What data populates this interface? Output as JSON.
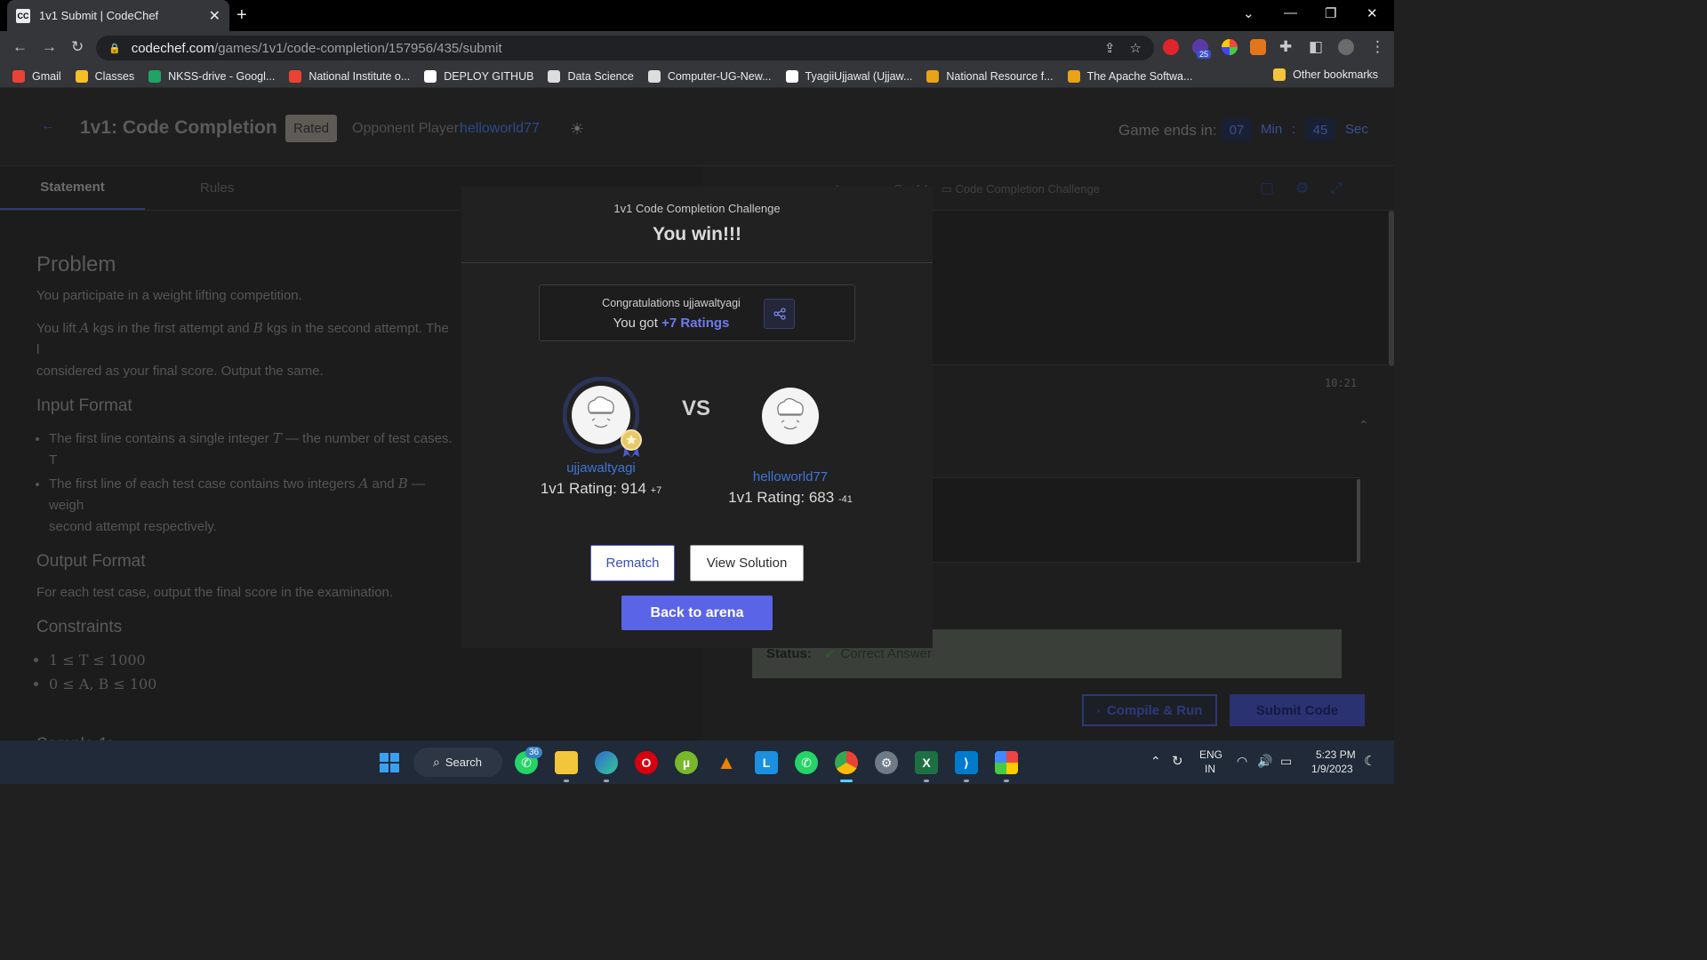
{
  "browser": {
    "tab_title": "1v1 Submit | CodeChef",
    "tab_favicon": "CC",
    "url_domain": "codechef.com",
    "url_path": "/games/1v1/code-completion/157956/435/submit",
    "extension_badge": "25",
    "bookmarks": [
      {
        "label": "Gmail",
        "icon": "gmail-icon",
        "color": "#ea4335"
      },
      {
        "label": "Classes",
        "icon": "classroom-icon",
        "color": "#f6c026"
      },
      {
        "label": "NKSS-drive - Googl...",
        "icon": "drive-icon",
        "color": "#1fa463"
      },
      {
        "label": "National Institute o...",
        "icon": "gmail-icon",
        "color": "#ea4335"
      },
      {
        "label": "DEPLOY GITHUB",
        "icon": "github-icon",
        "color": "#ffffff"
      },
      {
        "label": "Data Science",
        "icon": "page-icon",
        "color": "#dddddd"
      },
      {
        "label": "Computer-UG-New...",
        "icon": "globe-icon",
        "color": "#dddddd"
      },
      {
        "label": "TyagiiUjjawal (Ujjaw...",
        "icon": "github-icon",
        "color": "#ffffff"
      },
      {
        "label": "National Resource f...",
        "icon": "code-icon",
        "color": "#e8a317"
      },
      {
        "label": "The Apache Softwa...",
        "icon": "code-icon",
        "color": "#e8a317"
      }
    ],
    "other_bookmarks": "Other bookmarks"
  },
  "header": {
    "title": "1v1: Code Completion",
    "rated_badge": "Rated",
    "opponent_label": "Opponent Player:",
    "opponent_name": "helloworld77",
    "timer_label": "Game ends in:",
    "timer_min_value": "07",
    "timer_min_unit": "Min",
    "timer_sep": ":",
    "timer_sec_value": "45",
    "timer_sec_unit": "Sec"
  },
  "left_tabs": {
    "statement": "Statement",
    "rules": "Rules"
  },
  "problem": {
    "heading": "Problem",
    "p1": "You participate in a weight lifting competition.",
    "p2_a": "You lift ",
    "p2_var_a": "A",
    "p2_b": " kgs in the first attempt and ",
    "p2_var_b": "B",
    "p2_c": " kgs in the second attempt. The l",
    "p2_d": "considered as your final score. Output the same.",
    "input_heading": "Input Format",
    "input_1_a": "The first line contains a single integer ",
    "input_1_var": "T",
    "input_1_b": " — the number of test cases. T",
    "input_2_a": "The first line of each test case contains two integers ",
    "input_2_var_a": "A",
    "input_2_mid": " and ",
    "input_2_var_b": "B",
    "input_2_b": " — weigh",
    "input_2_c": "second attempt respectively.",
    "output_heading": "Output Format",
    "output_text": "For each test case, output the final score in the examination.",
    "constraints_heading": "Constraints",
    "constraint_1": "1 ≤ T ≤ 1000",
    "constraint_2": "0 ≤ A, B ≤ 100",
    "sample_heading": "Sample 1:"
  },
  "right_panel": {
    "language_fragment": "Language: C++14",
    "challenge_fragment": "Code Completion Challenge",
    "clock": "10:21",
    "status_label": "Status:",
    "status_value": "Correct Answer",
    "compile_button": "Compile & Run",
    "submit_button": "Submit Code"
  },
  "modal": {
    "subtitle": "1v1 Code Completion Challenge",
    "title": "You win!!!",
    "congrats_prefix": "Congratulations ",
    "congrats_user": "ujjawaltyagi",
    "you_got": "You got ",
    "rating_gain": "+7 Ratings",
    "vs": "VS",
    "player1": {
      "name": "ujjawaltyagi",
      "rating_label": "1v1 Rating: 914",
      "delta": "+7"
    },
    "player2": {
      "name": "helloworld77",
      "rating_label": "1v1 Rating: 683",
      "delta": "-41"
    },
    "rematch": "Rematch",
    "view_solution": "View Solution",
    "back_to_arena": "Back to arena"
  },
  "taskbar": {
    "search_label": "Search",
    "whatsapp_badge": "36",
    "lang_top": "ENG",
    "lang_bottom": "IN",
    "time": "5:23 PM",
    "date": "1/9/2023"
  },
  "colors": {
    "accent": "#5a64e6",
    "link": "#3e76d6",
    "rating_highlight": "#6c7bf2"
  }
}
